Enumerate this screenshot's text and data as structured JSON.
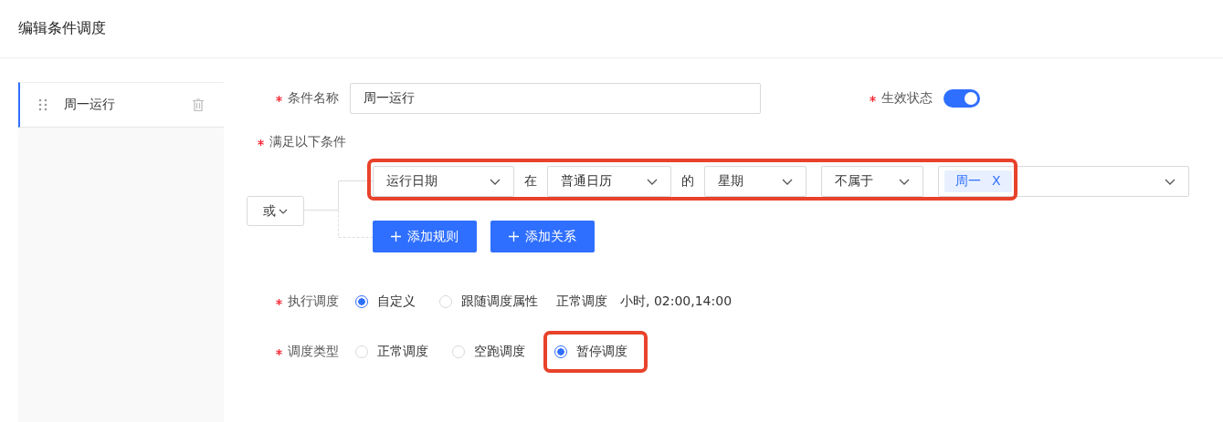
{
  "page": {
    "title": "编辑条件调度"
  },
  "sidebar": {
    "items": [
      {
        "label": "周一运行",
        "selected": true
      }
    ]
  },
  "form": {
    "name": {
      "label": "条件名称",
      "required": true,
      "value": "周一运行"
    },
    "active": {
      "label": "生效状态",
      "required": true,
      "on": true
    },
    "conditions": {
      "label": "满足以下条件",
      "required": true,
      "logic": "或",
      "rule": {
        "field": "运行日期",
        "connector_1": "在",
        "calendar": "普通日历",
        "connector_2": "的",
        "unit": "星期",
        "operator": "不属于",
        "tags": [
          {
            "label": "周一",
            "remove": "X"
          }
        ]
      },
      "buttons": [
        "添加规则",
        "添加关系"
      ]
    },
    "execute": {
      "label": "执行调度",
      "required": true,
      "options": [
        {
          "label": "自定义",
          "selected": true
        },
        {
          "label": "跟随调度属性",
          "selected": false
        }
      ],
      "info": [
        "正常调度",
        "小时, 02:00,14:00"
      ]
    },
    "schedule_type": {
      "label": "调度类型",
      "required": true,
      "options": [
        {
          "label": "正常调度",
          "selected": false
        },
        {
          "label": "空跑调度",
          "selected": false
        },
        {
          "label": "暂停调度",
          "selected": true
        }
      ]
    }
  }
}
